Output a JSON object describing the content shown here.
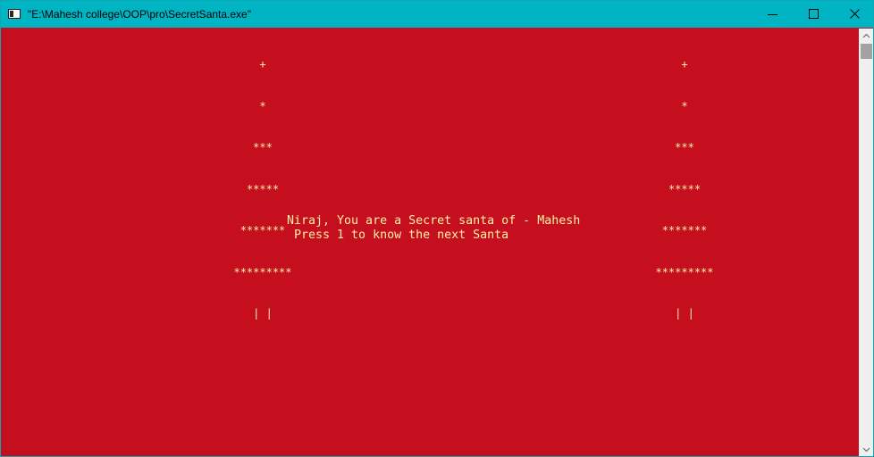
{
  "window": {
    "title": "\"E:\\Mahesh college\\OOP\\pro\\SecretSanta.exe\""
  },
  "console": {
    "tree_left": [
      "+",
      "*",
      "***",
      "*****",
      "*******",
      "*********",
      "| |"
    ],
    "tree_right": [
      "+",
      "*",
      "***",
      "*****",
      "*******",
      "*********",
      "| |"
    ],
    "message_line1": "Niraj, You are a Secret santa of - Mahesh",
    "message_line2": " Press 1 to know the next Santa"
  },
  "colors": {
    "background": "#c50f1f",
    "text": "#f9f1a5",
    "titlebar": "#00b4c4"
  },
  "icons": {
    "app": "console-app-icon",
    "minimize": "minimize-icon",
    "maximize": "maximize-icon",
    "close": "close-icon",
    "scroll_up": "scroll-up-arrow-icon",
    "scroll_down": "scroll-down-arrow-icon"
  }
}
